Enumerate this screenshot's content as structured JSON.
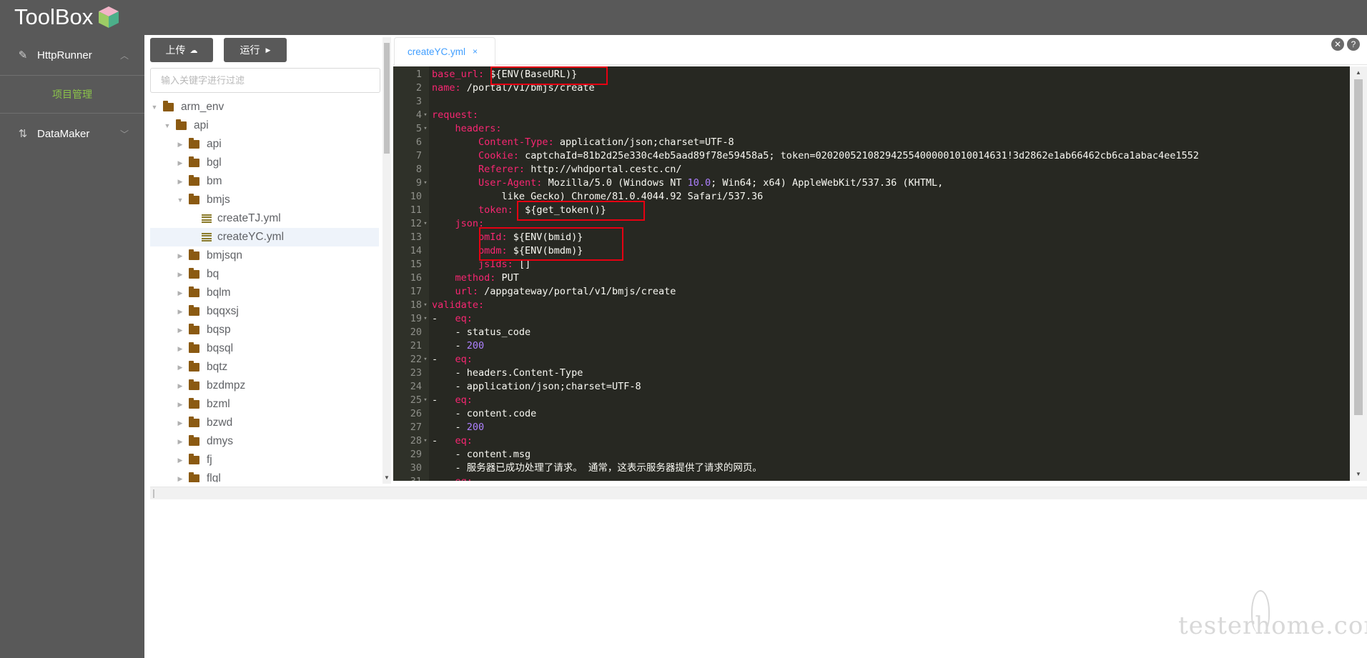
{
  "app": {
    "title": "ToolBox"
  },
  "sidebar": {
    "items": [
      {
        "label": "HttpRunner",
        "icon": "edit-icon",
        "expanded": true
      },
      {
        "label": "DataMaker",
        "icon": "sort-icon",
        "expanded": false
      }
    ],
    "sub_items": [
      {
        "label": "项目管理",
        "color": "#8bc34a"
      }
    ]
  },
  "toolbar": {
    "upload_label": "上传",
    "run_label": "运行"
  },
  "filter": {
    "placeholder": "输入关键字进行过滤",
    "value": ""
  },
  "tree": [
    {
      "label": "arm_env",
      "type": "folder",
      "level": 0,
      "expanded": true
    },
    {
      "label": "api",
      "type": "folder",
      "level": 1,
      "expanded": true
    },
    {
      "label": "api",
      "type": "folder",
      "level": 2,
      "expanded": false
    },
    {
      "label": "bgl",
      "type": "folder",
      "level": 2,
      "expanded": false
    },
    {
      "label": "bm",
      "type": "folder",
      "level": 2,
      "expanded": false
    },
    {
      "label": "bmjs",
      "type": "folder",
      "level": 2,
      "expanded": true
    },
    {
      "label": "createTJ.yml",
      "type": "file",
      "level": 3
    },
    {
      "label": "createYC.yml",
      "type": "file",
      "level": 3,
      "selected": true
    },
    {
      "label": "bmjsqn",
      "type": "folder",
      "level": 2,
      "expanded": false
    },
    {
      "label": "bq",
      "type": "folder",
      "level": 2,
      "expanded": false
    },
    {
      "label": "bqlm",
      "type": "folder",
      "level": 2,
      "expanded": false
    },
    {
      "label": "bqqxsj",
      "type": "folder",
      "level": 2,
      "expanded": false
    },
    {
      "label": "bqsp",
      "type": "folder",
      "level": 2,
      "expanded": false
    },
    {
      "label": "bqsql",
      "type": "folder",
      "level": 2,
      "expanded": false
    },
    {
      "label": "bqtz",
      "type": "folder",
      "level": 2,
      "expanded": false
    },
    {
      "label": "bzdmpz",
      "type": "folder",
      "level": 2,
      "expanded": false
    },
    {
      "label": "bzml",
      "type": "folder",
      "level": 2,
      "expanded": false
    },
    {
      "label": "bzwd",
      "type": "folder",
      "level": 2,
      "expanded": false
    },
    {
      "label": "dmys",
      "type": "folder",
      "level": 2,
      "expanded": false
    },
    {
      "label": "fj",
      "type": "folder",
      "level": 2,
      "expanded": false
    },
    {
      "label": "flgl",
      "type": "folder",
      "level": 2,
      "expanded": false
    }
  ],
  "editor": {
    "tab_label": "createYC.yml",
    "tab_close": "×",
    "lines": [
      {
        "n": "1",
        "fold": "",
        "parts": [
          [
            "k",
            "base_url:"
          ],
          [
            "d",
            " ${ENV(BaseURL)}"
          ]
        ]
      },
      {
        "n": "2",
        "fold": "",
        "parts": [
          [
            "k",
            "name:"
          ],
          [
            "d",
            " /portal/v1/bmjs/create"
          ]
        ]
      },
      {
        "n": "3",
        "fold": "",
        "parts": [
          [
            "d",
            ""
          ]
        ]
      },
      {
        "n": "4",
        "fold": "▾",
        "parts": [
          [
            "k",
            "request:"
          ]
        ]
      },
      {
        "n": "5",
        "fold": "▾",
        "parts": [
          [
            "d",
            "    "
          ],
          [
            "k",
            "headers:"
          ]
        ]
      },
      {
        "n": "6",
        "fold": "",
        "parts": [
          [
            "d",
            "        "
          ],
          [
            "k",
            "Content-Type:"
          ],
          [
            "d",
            " application/json;charset=UTF-8"
          ]
        ]
      },
      {
        "n": "7",
        "fold": "",
        "parts": [
          [
            "d",
            "        "
          ],
          [
            "k",
            "Cookie:"
          ],
          [
            "d",
            " captchaId=81b2d25e330c4eb5aad89f78e59458a5; token=020200521082942554000001010014631!3d2862e1ab66462cb6ca1abac4ee1552"
          ]
        ]
      },
      {
        "n": "8",
        "fold": "",
        "parts": [
          [
            "d",
            "        "
          ],
          [
            "k",
            "Referer:"
          ],
          [
            "d",
            " http://whdportal.cestc.cn/"
          ]
        ]
      },
      {
        "n": "9",
        "fold": "▾",
        "parts": [
          [
            "d",
            "        "
          ],
          [
            "k",
            "User-Agent:"
          ],
          [
            "d",
            " Mozilla/5.0 (Windows NT "
          ],
          [
            "n",
            "10.0"
          ],
          [
            "d",
            "; Win64; x64) AppleWebKit/537.36 (KHTML,"
          ]
        ]
      },
      {
        "n": "10",
        "fold": "",
        "parts": [
          [
            "d",
            "            like Gecko) Chrome/81.0.4044.92 Safari/537.36"
          ]
        ]
      },
      {
        "n": "11",
        "fold": "",
        "parts": [
          [
            "d",
            "        "
          ],
          [
            "k",
            "token:"
          ],
          [
            "d",
            "  ${get_token()}"
          ]
        ]
      },
      {
        "n": "12",
        "fold": "▾",
        "parts": [
          [
            "d",
            "    "
          ],
          [
            "k",
            "json:"
          ]
        ]
      },
      {
        "n": "13",
        "fold": "",
        "parts": [
          [
            "d",
            "        "
          ],
          [
            "k",
            "bmId:"
          ],
          [
            "d",
            " ${ENV(bmid)}"
          ]
        ]
      },
      {
        "n": "14",
        "fold": "",
        "parts": [
          [
            "d",
            "        "
          ],
          [
            "k",
            "bmdm:"
          ],
          [
            "d",
            " ${ENV(bmdm)}"
          ]
        ]
      },
      {
        "n": "15",
        "fold": "",
        "parts": [
          [
            "d",
            "        "
          ],
          [
            "k",
            "jsIds:"
          ],
          [
            "d",
            " []"
          ]
        ]
      },
      {
        "n": "16",
        "fold": "",
        "parts": [
          [
            "d",
            "    "
          ],
          [
            "k",
            "method:"
          ],
          [
            "d",
            " PUT"
          ]
        ]
      },
      {
        "n": "17",
        "fold": "",
        "parts": [
          [
            "d",
            "    "
          ],
          [
            "k",
            "url:"
          ],
          [
            "d",
            " /appgateway/portal/v1/bmjs/create"
          ]
        ]
      },
      {
        "n": "18",
        "fold": "▾",
        "parts": [
          [
            "k",
            "validate:"
          ]
        ]
      },
      {
        "n": "19",
        "fold": "▾",
        "parts": [
          [
            "d",
            "-   "
          ],
          [
            "k",
            "eq:"
          ]
        ]
      },
      {
        "n": "20",
        "fold": "",
        "parts": [
          [
            "d",
            "    - status_code"
          ]
        ]
      },
      {
        "n": "21",
        "fold": "",
        "parts": [
          [
            "d",
            "    - "
          ],
          [
            "n",
            "200"
          ]
        ]
      },
      {
        "n": "22",
        "fold": "▾",
        "parts": [
          [
            "d",
            "-   "
          ],
          [
            "k",
            "eq:"
          ]
        ]
      },
      {
        "n": "23",
        "fold": "",
        "parts": [
          [
            "d",
            "    - headers.Content-Type"
          ]
        ]
      },
      {
        "n": "24",
        "fold": "",
        "parts": [
          [
            "d",
            "    - application/json;charset=UTF-8"
          ]
        ]
      },
      {
        "n": "25",
        "fold": "▾",
        "parts": [
          [
            "d",
            "-   "
          ],
          [
            "k",
            "eq:"
          ]
        ]
      },
      {
        "n": "26",
        "fold": "",
        "parts": [
          [
            "d",
            "    - content.code"
          ]
        ]
      },
      {
        "n": "27",
        "fold": "",
        "parts": [
          [
            "d",
            "    - "
          ],
          [
            "n",
            "200"
          ]
        ]
      },
      {
        "n": "28",
        "fold": "▾",
        "parts": [
          [
            "d",
            "-   "
          ],
          [
            "k",
            "eq:"
          ]
        ]
      },
      {
        "n": "29",
        "fold": "",
        "parts": [
          [
            "d",
            "    - content.msg"
          ]
        ]
      },
      {
        "n": "30",
        "fold": "",
        "parts": [
          [
            "d",
            "    - 服务器已成功处理了请求。 通常，这表示服务器提供了请求的网页。"
          ]
        ]
      },
      {
        "n": "31",
        "fold": "",
        "parts": [
          [
            "d",
            "    "
          ],
          [
            "k",
            "eq:"
          ]
        ]
      }
    ]
  },
  "controls": {
    "close_label": "✕",
    "help_label": "?"
  },
  "watermark": {
    "text": "testerhome.com"
  },
  "colors": {
    "topbar": "#595959",
    "editor_bg": "#272822",
    "keyword": "#f92672",
    "number": "#ae81ff",
    "accent": "#409eff",
    "highlight_box": "#e60012"
  }
}
